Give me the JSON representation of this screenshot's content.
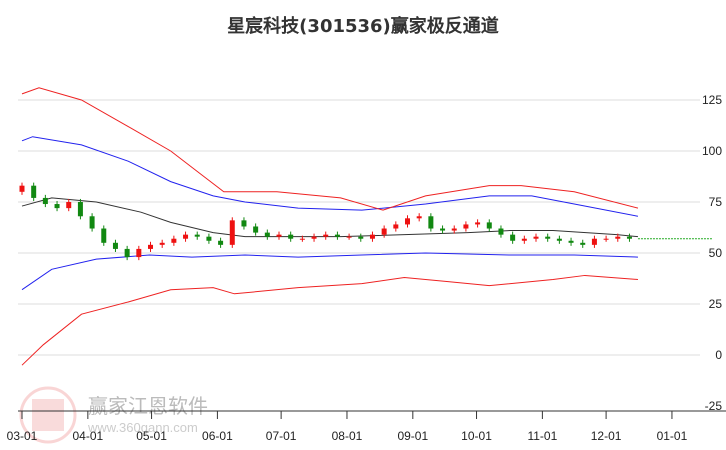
{
  "chart_data": {
    "type": "line",
    "title": "星宸科技(301536)赢家极反通道",
    "x_unit": "days since 03-01",
    "xticks": [
      {
        "label": "03-01",
        "day": 0
      },
      {
        "label": "04-01",
        "day": 31
      },
      {
        "label": "05-01",
        "day": 61
      },
      {
        "label": "06-01",
        "day": 92
      },
      {
        "label": "07-01",
        "day": 122
      },
      {
        "label": "08-01",
        "day": 153
      },
      {
        "label": "09-01",
        "day": 184
      },
      {
        "label": "10-01",
        "day": 214
      },
      {
        "label": "11-01",
        "day": 245
      },
      {
        "label": "12-01",
        "day": 275
      },
      {
        "label": "01-01",
        "day": 306
      }
    ],
    "yticks": [
      125,
      100,
      75,
      50,
      25,
      0,
      -25
    ],
    "ylim": [
      -25,
      135
    ],
    "xlim": [
      -1,
      325
    ],
    "grid": true,
    "price_closes_weekly": [
      83,
      77,
      74,
      72,
      75,
      68,
      62,
      55,
      52,
      48,
      52,
      54,
      55,
      57,
      59,
      58,
      56,
      54,
      66,
      63,
      60,
      58,
      59,
      57,
      57,
      58,
      59,
      58,
      58,
      57,
      59,
      62,
      64,
      67,
      68,
      62,
      61,
      62,
      64,
      65,
      62,
      59,
      56,
      57,
      58,
      57,
      56,
      55,
      54,
      57,
      57,
      58,
      57
    ],
    "price_open_first": 80,
    "price_day_step": 5.5,
    "series": [
      {
        "name": "middle",
        "color": "#333333",
        "points": [
          [
            0,
            73
          ],
          [
            14,
            77
          ],
          [
            35,
            75
          ],
          [
            56,
            70
          ],
          [
            70,
            65
          ],
          [
            90,
            60
          ],
          [
            105,
            58
          ],
          [
            150,
            58
          ],
          [
            210,
            60
          ],
          [
            230,
            61
          ],
          [
            250,
            61
          ],
          [
            280,
            59
          ],
          [
            290,
            58
          ]
        ]
      },
      {
        "name": "upper-blue",
        "color": "#2222ee",
        "points": [
          [
            0,
            105
          ],
          [
            5,
            107
          ],
          [
            28,
            103
          ],
          [
            50,
            95
          ],
          [
            70,
            85
          ],
          [
            90,
            78
          ],
          [
            105,
            75
          ],
          [
            130,
            72
          ],
          [
            160,
            71
          ],
          [
            190,
            74
          ],
          [
            220,
            78
          ],
          [
            240,
            78
          ],
          [
            260,
            74
          ],
          [
            290,
            68
          ]
        ]
      },
      {
        "name": "lower-blue",
        "color": "#2222ee",
        "points": [
          [
            0,
            32
          ],
          [
            14,
            42
          ],
          [
            35,
            47
          ],
          [
            60,
            49
          ],
          [
            80,
            48
          ],
          [
            105,
            49
          ],
          [
            130,
            48
          ],
          [
            160,
            49
          ],
          [
            190,
            50
          ],
          [
            230,
            49
          ],
          [
            260,
            49
          ],
          [
            290,
            48
          ]
        ]
      },
      {
        "name": "upper-red",
        "color": "#ee2222",
        "points": [
          [
            0,
            128
          ],
          [
            8,
            131
          ],
          [
            28,
            125
          ],
          [
            50,
            112
          ],
          [
            70,
            100
          ],
          [
            85,
            88
          ],
          [
            95,
            80
          ],
          [
            120,
            80
          ],
          [
            150,
            77
          ],
          [
            170,
            71
          ],
          [
            190,
            78
          ],
          [
            220,
            83
          ],
          [
            235,
            83
          ],
          [
            260,
            80
          ],
          [
            290,
            72
          ]
        ]
      },
      {
        "name": "lower-red",
        "color": "#ee2222",
        "points": [
          [
            0,
            -5
          ],
          [
            10,
            5
          ],
          [
            28,
            20
          ],
          [
            50,
            26
          ],
          [
            70,
            32
          ],
          [
            90,
            33
          ],
          [
            100,
            30
          ],
          [
            130,
            33
          ],
          [
            160,
            35
          ],
          [
            180,
            38
          ],
          [
            200,
            36
          ],
          [
            220,
            34
          ],
          [
            250,
            37
          ],
          [
            265,
            39
          ],
          [
            290,
            37
          ]
        ]
      }
    ],
    "projection": {
      "color": "#22aa22",
      "value": 57,
      "from_day": 290,
      "to_day": 325
    }
  },
  "watermark": {
    "name": "赢家江恩软件",
    "url": "www.360gann.com",
    "seal": "江赢恩家"
  }
}
